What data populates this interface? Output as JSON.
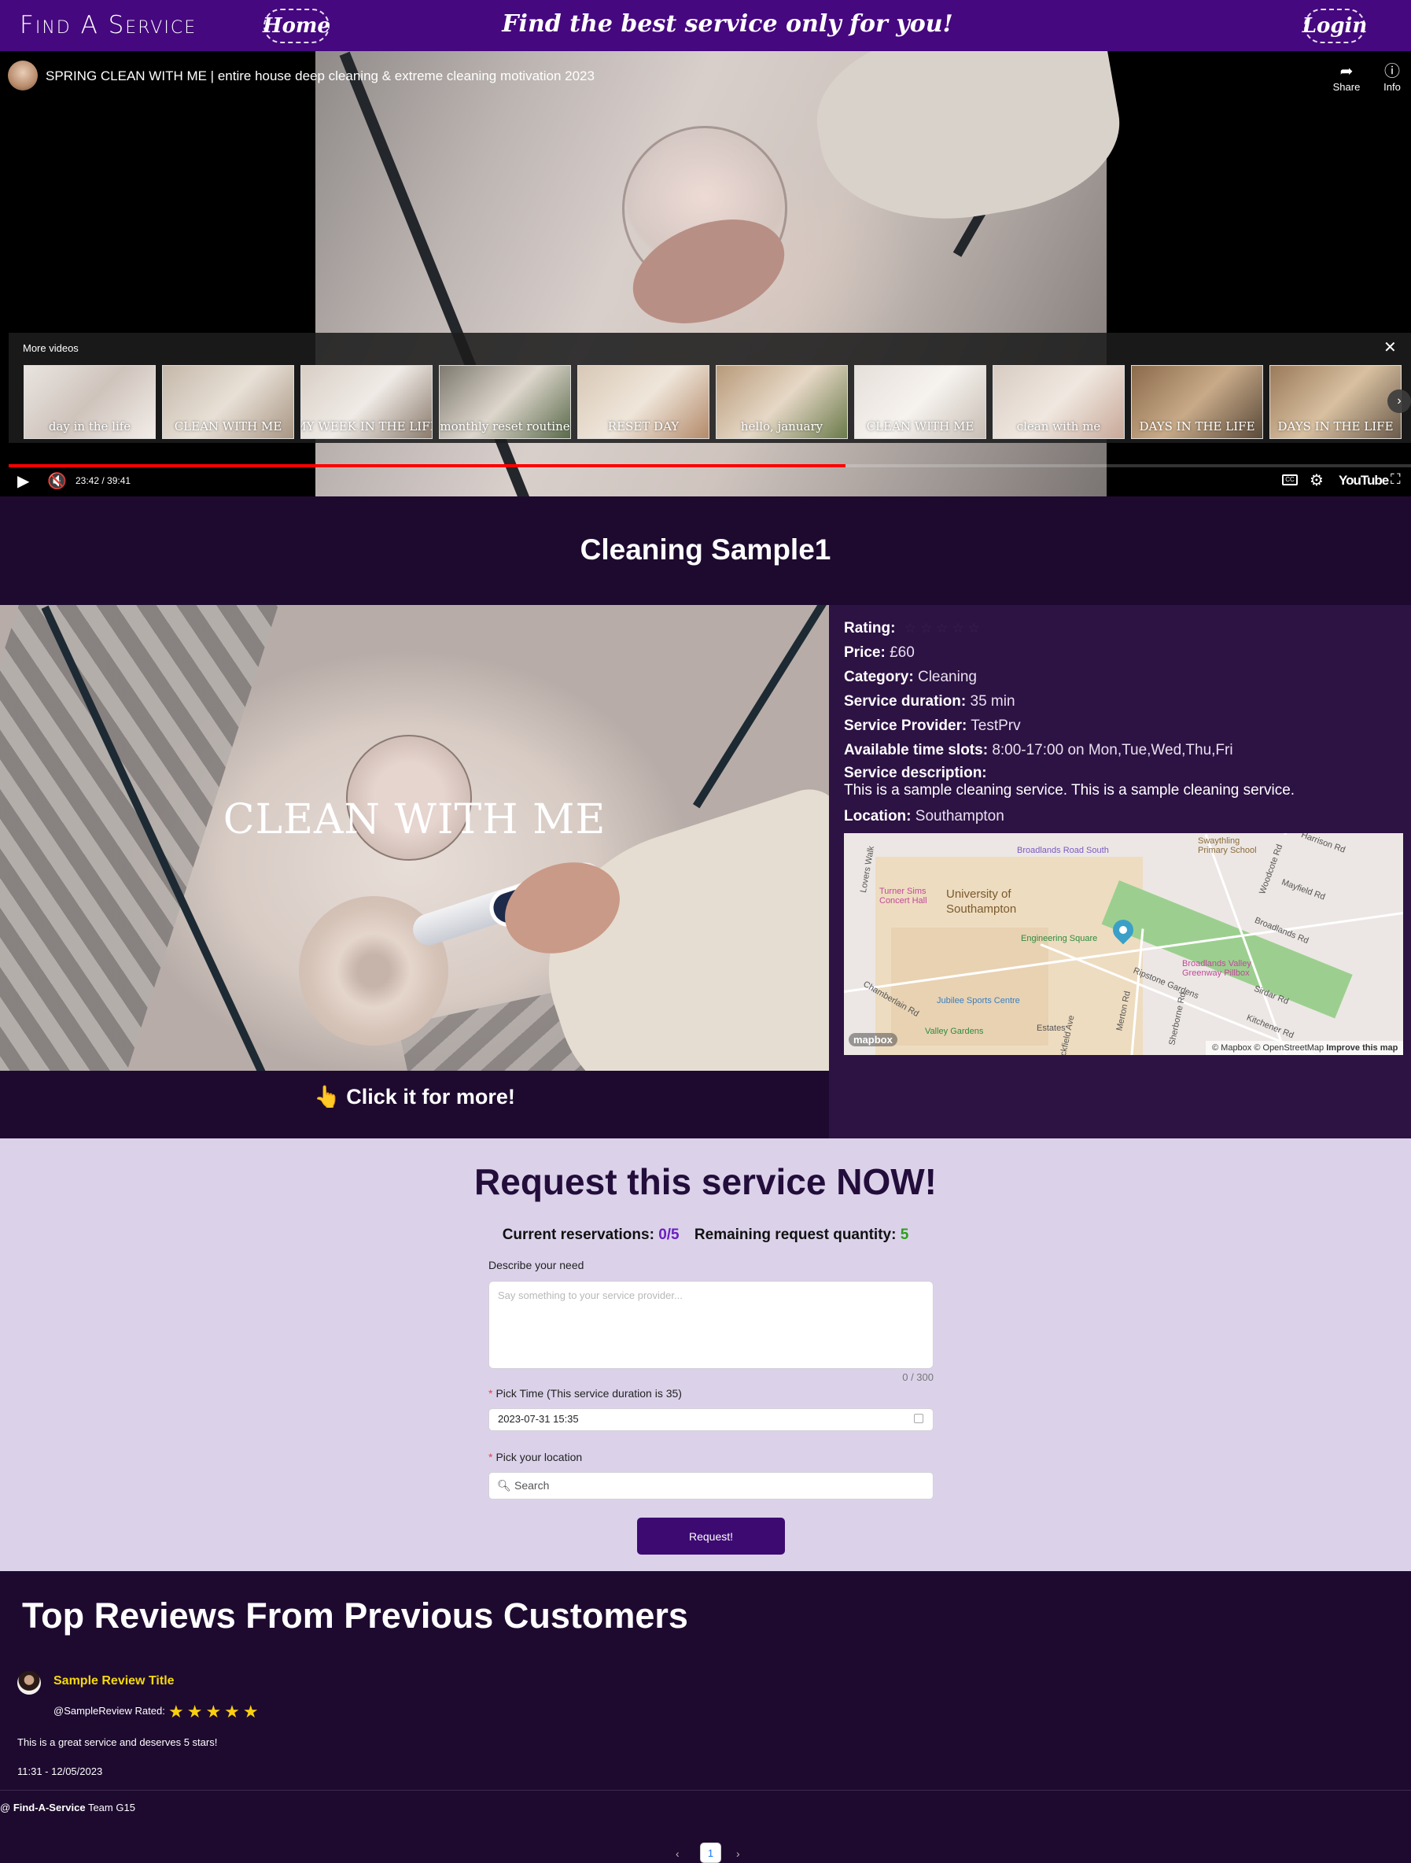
{
  "header": {
    "brand": "Find A Service",
    "home_label": "Home",
    "tagline": "Find the best service only for you!",
    "login_label": "Login",
    "bg_color": "#45087f"
  },
  "video": {
    "title": "SPRING CLEAN WITH ME | entire house deep cleaning & extreme cleaning motivation 2023",
    "share_label": "Share",
    "info_label": "Info",
    "more_videos_label": "More videos",
    "thumbnails": [
      {
        "caption": "day in the life"
      },
      {
        "caption": "CLEAN WITH ME"
      },
      {
        "caption": "MY WEEK IN THE LIFE"
      },
      {
        "caption": "monthly reset routine"
      },
      {
        "caption": "RESET DAY"
      },
      {
        "caption": "hello, january"
      },
      {
        "caption": "CLEAN WITH ME"
      },
      {
        "caption": "clean with me"
      },
      {
        "caption": "DAYS IN THE LIFE"
      },
      {
        "caption": "DAYS IN THE LIFE"
      }
    ],
    "time": "23:42 / 39:41",
    "progress_fraction": 0.597,
    "youtube_label": "YouTube"
  },
  "service": {
    "title": "Cleaning Sample1",
    "overlay_text": "CLEAN WITH ME",
    "rating_label": "Rating:",
    "rating_value": 0,
    "rating_max": 5,
    "price_label": "Price:",
    "price": "£60",
    "category_label": "Category:",
    "category": "Cleaning",
    "duration_label": "Service duration:",
    "duration": "35 min",
    "provider_label": "Service Provider:",
    "provider": "TestPrv",
    "slots_label": "Available time slots:",
    "slots": "8:00-17:00 on Mon,Tue,Wed,Thu,Fri",
    "description_label": "Service description:",
    "description": "This is a sample cleaning service. This is a sample cleaning service.",
    "location_label": "Location:",
    "location": "Southampton",
    "click_more": "👆 Click it for more!"
  },
  "map": {
    "labels": {
      "broadlands_road_south": "Broadlands Road South",
      "swaythling": "Swaythling Primary School",
      "harrison": "Harrison Rd",
      "lovers_walk": "Lovers Walk",
      "woodcote": "Woodcote Rd",
      "turner_sims": "Turner Sims Concert Hall",
      "university": "University of Southampton",
      "mayfield": "Mayfield Rd",
      "engineering": "Engineering Square",
      "broadlands_rd": "Broadlands Rd",
      "broadlands_valley": "Broadlands Valley Greenway Pillbox",
      "ripstone": "Ripstone Gardens",
      "chamberlain": "Chamberlain Rd",
      "jubilee": "Jubilee Sports Centre",
      "sirdar": "Sirdar Rd",
      "merton": "Merton Rd",
      "sherborne": "Sherborne Rd",
      "valley_gardens": "Valley Gardens",
      "estates": "Estates",
      "kitchener": "Kitchener Rd",
      "brickfield": "Brickfield Ave"
    },
    "logo": "mapbox",
    "attribution": "© Mapbox © OpenStreetMap",
    "improve": "Improve this map"
  },
  "request": {
    "title": "Request this service NOW!",
    "reservations_label": "Current reservations:",
    "reservations_value": "0/5",
    "remaining_label": "Remaining request quantity:",
    "remaining_value": "5",
    "describe_label": "Describe your need",
    "describe_placeholder": "Say something to your service provider...",
    "counter": "0 / 300",
    "pick_time_label": "Pick Time (This service duration is 35)",
    "pick_time_value": "2023-07-31 15:35",
    "pick_location_label": "Pick your location",
    "search_placeholder": "Search",
    "submit_label": "Request!",
    "required_mark": "*"
  },
  "reviews": {
    "title": "Top Reviews From Previous Customers",
    "items": [
      {
        "title": "Sample Review Title",
        "handle": "@SampleReview Rated:",
        "stars": 5,
        "stars_text": "★★★★★",
        "text": "This is a great service and deserves 5 stars!",
        "date": "11:31 - 12/05/2023"
      }
    ]
  },
  "footer": {
    "prefix": "@ ",
    "brand": "Find-A-Service",
    "team": "Team G15"
  },
  "pagination": {
    "current_page": "1",
    "prev_label": "‹",
    "next_label": "›"
  }
}
